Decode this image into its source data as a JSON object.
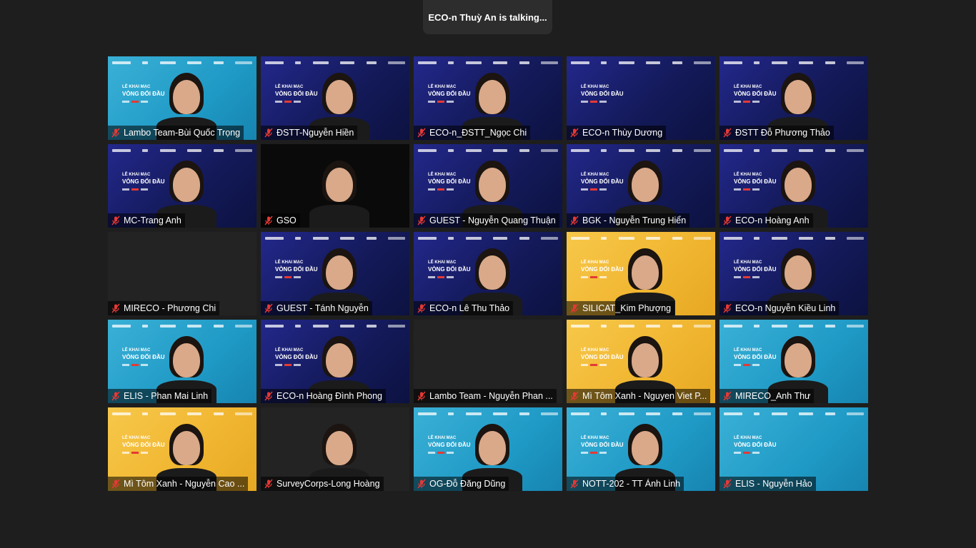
{
  "banner": {
    "text": "ECO-n Thuỳ An is talking..."
  },
  "backdrop": {
    "line1": "LỄ KHAI MẠC",
    "line2": "VÒNG ĐỐI ĐẦU"
  },
  "colors": {
    "mic_muted": "#e53935",
    "background": "#1e1e1e",
    "backdrop_blue": "#141a5a",
    "backdrop_cyan": "#1f9ac6",
    "backdrop_yellow": "#f0b530"
  },
  "participants": [
    {
      "name": "Lambo Team-Bùi Quốc Trọng",
      "muted": true
    },
    {
      "name": "ĐSTT-Nguyễn Hiền",
      "muted": true
    },
    {
      "name": "ECO-n_ĐSTT_Ngọc Chi",
      "muted": true
    },
    {
      "name": "ECO-n Thùy Dương",
      "muted": true
    },
    {
      "name": "ĐSTT Đỗ Phương Thảo",
      "muted": true
    },
    {
      "name": "MC-Trang Anh",
      "muted": true
    },
    {
      "name": "GSO",
      "muted": true
    },
    {
      "name": "GUEST - Nguyễn Quang Thuận",
      "muted": true
    },
    {
      "name": "BGK - Nguyễn Trung Hiển",
      "muted": true
    },
    {
      "name": "ECO-n Hoàng Anh",
      "muted": true
    },
    {
      "name": "MIRECO - Phương Chi",
      "muted": true
    },
    {
      "name": "GUEST - Tánh Nguyễn",
      "muted": true
    },
    {
      "name": "ECO-n Lê Thu Thảo",
      "muted": true
    },
    {
      "name": "SILICAT_Kim Phượng",
      "muted": true
    },
    {
      "name": "ECO-n Nguyễn Kiều Linh",
      "muted": true
    },
    {
      "name": "ELIS - Phan Mai Linh",
      "muted": true
    },
    {
      "name": "ECO-n Hoàng Đình Phong",
      "muted": true
    },
    {
      "name": "Lambo Team - Nguyễn Phan ...",
      "muted": true
    },
    {
      "name": "Mì Tôm Xanh - Nguyen Viet P...",
      "muted": true
    },
    {
      "name": "MIRECO_Anh Thư",
      "muted": true
    },
    {
      "name": "Mì Tôm Xanh - Nguyễn Cao ...",
      "muted": true
    },
    {
      "name": "SurveyCorps-Long Hoàng",
      "muted": true
    },
    {
      "name": "OG-Đỗ Đăng Dũng",
      "muted": true
    },
    {
      "name": "NOTT-202 - TT Ánh Linh",
      "muted": true
    },
    {
      "name": "ELIS - Nguyễn Hảo",
      "muted": true
    }
  ]
}
